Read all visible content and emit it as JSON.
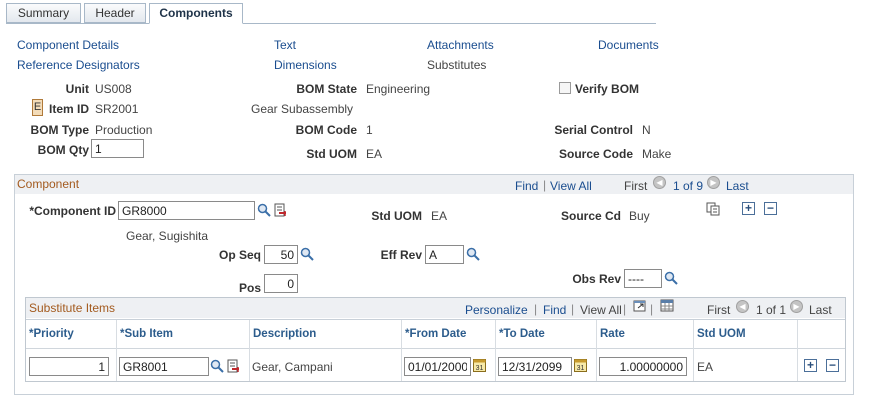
{
  "tabs": [
    "Summary",
    "Header",
    "Components"
  ],
  "links": {
    "component_details": "Component Details",
    "text": "Text",
    "attachments": "Attachments",
    "documents": "Documents",
    "reference_designators": "Reference Designators",
    "dimensions": "Dimensions",
    "substitutes": "Substitutes"
  },
  "header": {
    "unit_label": "Unit",
    "unit_value": "US008",
    "bom_state_label": "BOM State",
    "bom_state_value": "Engineering",
    "verify_bom_label": "Verify BOM",
    "e_button": "E",
    "item_id_label": "Item ID",
    "item_id_value": "SR2001",
    "item_desc": "Gear Subassembly",
    "bom_type_label": "BOM Type",
    "bom_type_value": "Production",
    "bom_code_label": "BOM Code",
    "bom_code_value": "1",
    "serial_control_label": "Serial Control",
    "serial_control_value": "N",
    "bom_qty_label": "BOM Qty",
    "bom_qty_value": "1",
    "std_uom_label": "Std UOM",
    "std_uom_value": "EA",
    "source_code_label": "Source Code",
    "source_code_value": "Make"
  },
  "component": {
    "title": "Component",
    "find": "Find",
    "view_all": "View All",
    "first": "First",
    "counter": "1 of 9",
    "last": "Last",
    "component_id_label": "*Component ID",
    "component_id_value": "GR8000",
    "std_uom_label": "Std UOM",
    "std_uom_value": "EA",
    "source_cd_label": "Source Cd",
    "source_cd_value": "Buy",
    "component_desc": "Gear, Sugishita",
    "op_seq_label": "Op Seq",
    "op_seq_value": "50",
    "eff_rev_label": "Eff Rev",
    "eff_rev_value": "A",
    "pos_label": "Pos",
    "pos_value": "0",
    "obs_rev_label": "Obs Rev",
    "obs_rev_value": "----"
  },
  "substitutes": {
    "title": "Substitute Items",
    "personalize": "Personalize",
    "find": "Find",
    "view_all": "View All",
    "first": "First",
    "counter": "1 of 1",
    "last": "Last",
    "columns": [
      "*Priority",
      "*Sub Item",
      "Description",
      "*From Date",
      "*To Date",
      "Rate",
      "Std UOM"
    ],
    "rows": [
      {
        "priority": "1",
        "sub_item": "GR8001",
        "description": "Gear, Campani",
        "from_date": "01/01/2000",
        "to_date": "12/31/2099",
        "rate": "1.00000000",
        "std_uom": "EA"
      }
    ]
  }
}
